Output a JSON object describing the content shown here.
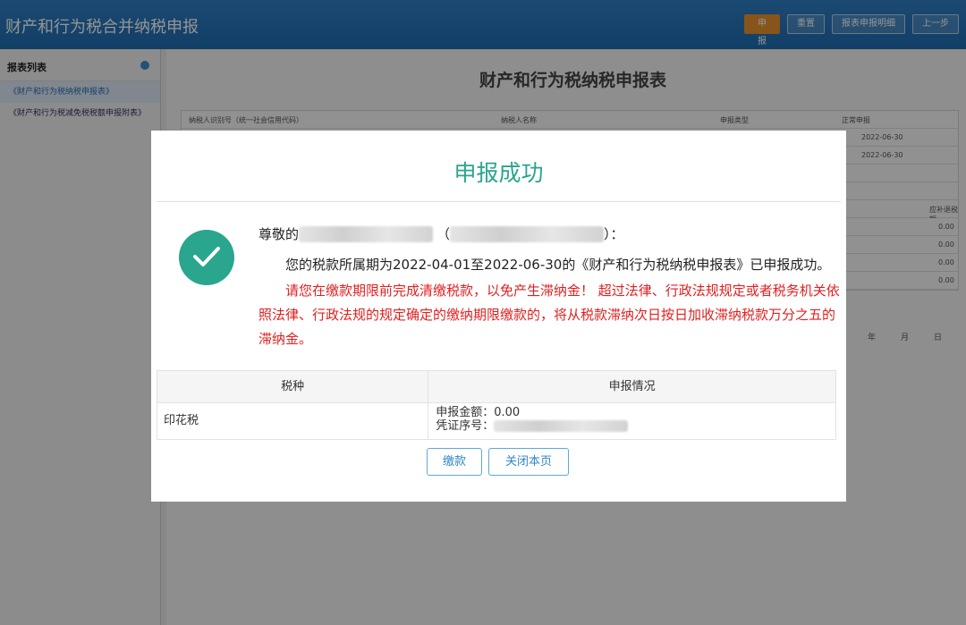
{
  "header": {
    "title": "财产和行为税合并纳税申报",
    "buttons": [
      "申报",
      "重置",
      "报表申报明细",
      "上一步"
    ]
  },
  "sidebar": {
    "title": "报表列表",
    "items": [
      {
        "label": "《财产和行为税纳税申报表》",
        "active": true
      },
      {
        "label": "《财产和行为税减免税税额申报附表》",
        "active": false
      }
    ]
  },
  "form": {
    "title": "财产和行为税纳税申报表",
    "fields": [
      "纳税人识别号（统一社会信用代码）",
      "纳税人名称",
      "申报类型",
      "正常申报"
    ],
    "dates": [
      "2022-06-30",
      "2022-06-30"
    ],
    "side_values": [
      "0.00",
      "0.00",
      "0.00",
      "0.00"
    ],
    "side_headers": [
      "应补退税额"
    ],
    "ymd": [
      "年",
      "月",
      "日"
    ]
  },
  "modal": {
    "title": "申报成功",
    "greeting_prefix": "尊敬的",
    "open_paren": "（",
    "close_paren": "）：",
    "success_line": "您的税款所属期为2022-04-01至2022-06-30的《财产和行为税纳税申报表》已申报成功。",
    "warning": "请您在缴款期限前完成清缴税款，以免产生滞纳金！ 超过法律、行政法规规定或者税务机关依照法律、行政法规的规定确定的缴纳期限缴款的，将从税款滞纳次日按日加收滞纳税款万分之五的滞纳金。",
    "table": {
      "headers": [
        "税种",
        "申报情况"
      ],
      "rows": [
        {
          "tax": "印花税",
          "amount_label": "申报金额：0.00",
          "voucher_label": "凭证序号："
        }
      ]
    },
    "buttons": {
      "pay": "缴款",
      "close": "关闭本页"
    }
  },
  "colors": {
    "accent": "#2aa58e",
    "warning": "#e02020",
    "header": "#2f7fc4",
    "primary_button": "#e8912c"
  }
}
